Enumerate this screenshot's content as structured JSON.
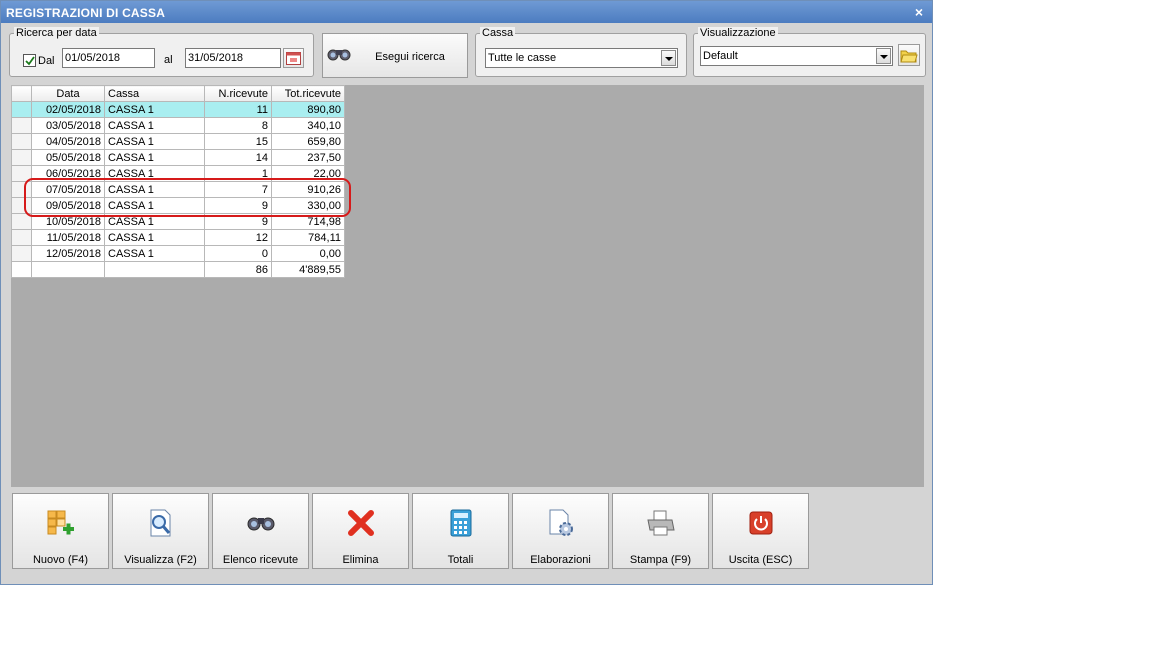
{
  "window": {
    "title": "REGISTRAZIONI DI CASSA",
    "close_glyph": "×"
  },
  "search_by_date": {
    "legend": "Ricerca per data",
    "checkbox_label": "Dal",
    "checkbox_checked": true,
    "from_date": "01/05/2018",
    "to_label": "al",
    "to_date": "31/05/2018",
    "calendar_icon": "calendar-icon"
  },
  "search_button": {
    "label": "Esegui ricerca",
    "icon": "binoculars-icon"
  },
  "cassa": {
    "legend": "Cassa",
    "selected": "Tutte le casse"
  },
  "visualizzazione": {
    "legend": "Visualizzazione",
    "selected": "Default",
    "folder_icon": "folder-icon"
  },
  "grid": {
    "columns": [
      "Data",
      "Cassa",
      "N.ricevute",
      "Tot.ricevute"
    ],
    "rows": [
      {
        "data": "02/05/2018",
        "cassa": "CASSA 1",
        "n": "11",
        "tot": "890,80"
      },
      {
        "data": "03/05/2018",
        "cassa": "CASSA 1",
        "n": "8",
        "tot": "340,10"
      },
      {
        "data": "04/05/2018",
        "cassa": "CASSA 1",
        "n": "15",
        "tot": "659,80"
      },
      {
        "data": "05/05/2018",
        "cassa": "CASSA 1",
        "n": "14",
        "tot": "237,50"
      },
      {
        "data": "06/05/2018",
        "cassa": "CASSA 1",
        "n": "1",
        "tot": "22,00"
      },
      {
        "data": "07/05/2018",
        "cassa": "CASSA 1",
        "n": "7",
        "tot": "910,26"
      },
      {
        "data": "09/05/2018",
        "cassa": "CASSA 1",
        "n": "9",
        "tot": "330,00"
      },
      {
        "data": "10/05/2018",
        "cassa": "CASSA 1",
        "n": "9",
        "tot": "714,98"
      },
      {
        "data": "11/05/2018",
        "cassa": "CASSA 1",
        "n": "12",
        "tot": "784,11"
      },
      {
        "data": "12/05/2018",
        "cassa": "CASSA 1",
        "n": "0",
        "tot": "0,00"
      }
    ],
    "totals": {
      "n": "86",
      "tot": "4'889,55"
    },
    "selected_row": 0,
    "highlight_color": "#d61a1a",
    "selection_color": "#a9eef0"
  },
  "toolbar": [
    {
      "label": "Nuovo (F4)",
      "icon": "new-grid-icon"
    },
    {
      "label": "Visualizza (F2)",
      "icon": "magnifier-document-icon"
    },
    {
      "label": "Elenco ricevute",
      "icon": "binoculars-icon"
    },
    {
      "label": "Elimina",
      "icon": "red-x-icon"
    },
    {
      "label": "Totali",
      "icon": "calculator-icon"
    },
    {
      "label": "Elaborazioni",
      "icon": "gear-document-icon"
    },
    {
      "label": "Stampa (F9)",
      "icon": "printer-icon"
    },
    {
      "label": "Uscita (ESC)",
      "icon": "power-icon"
    }
  ]
}
